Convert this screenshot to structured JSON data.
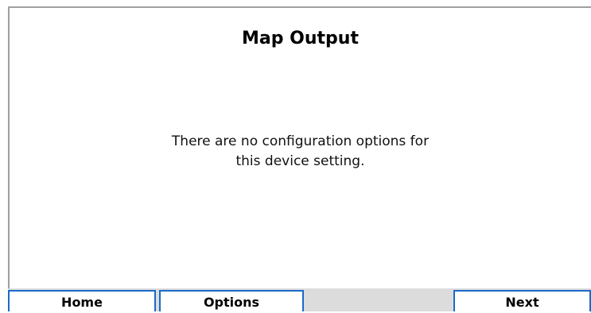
{
  "screen": {
    "title": "Map Output",
    "message_line1": "There are no configuration options for",
    "message_line2": "this device setting."
  },
  "nav": {
    "home_label": "Home",
    "options_label": "Options",
    "next_label": "Next"
  },
  "colors": {
    "accent_border": "#1b6ac9",
    "bar_background": "#dcdcdc"
  }
}
